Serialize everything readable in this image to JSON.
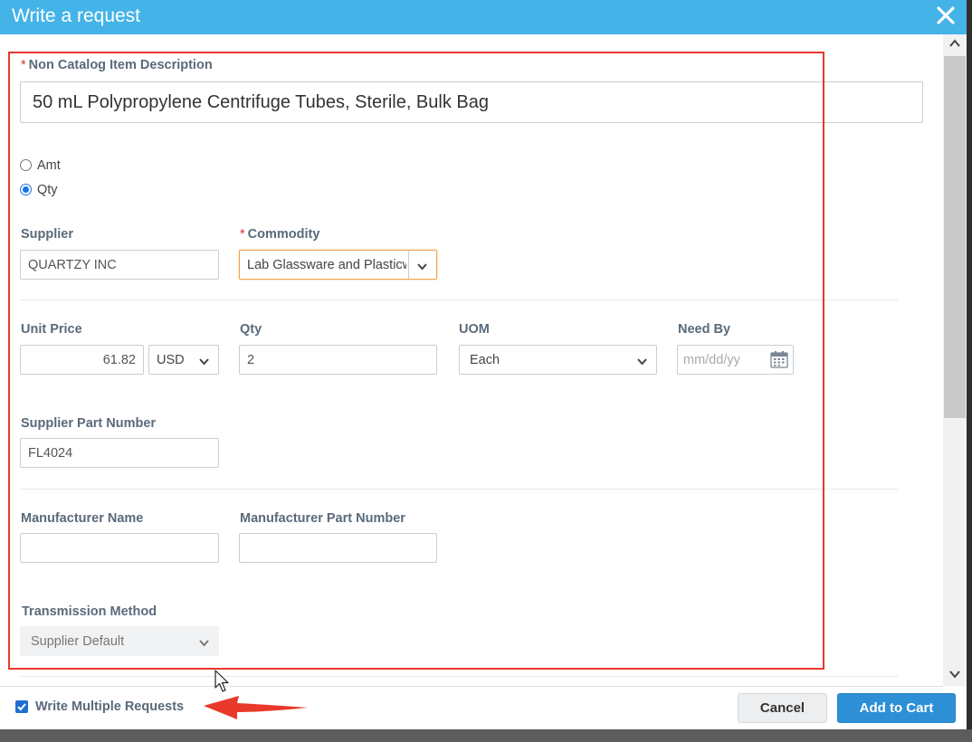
{
  "dialog": {
    "title": "Write a request",
    "colors": {
      "header": "#44b3e8",
      "accent": "#2d8fd5",
      "required": "#d9342b",
      "highlight": "#e8392b"
    }
  },
  "form": {
    "description": {
      "label": "Non Catalog Item Description",
      "value": "50 mL Polypropylene Centrifuge Tubes, Sterile, Bulk Bag"
    },
    "price_type": {
      "options": [
        "Amt",
        "Qty"
      ],
      "selected": "Qty"
    },
    "supplier": {
      "label": "Supplier",
      "value": "QUARTZY INC"
    },
    "commodity": {
      "label": "Commodity",
      "value": "Lab Glassware and Plasticw"
    },
    "unit_price": {
      "label": "Unit Price",
      "value": "61.82",
      "currency": "USD"
    },
    "qty": {
      "label": "Qty",
      "value": "2"
    },
    "uom": {
      "label": "UOM",
      "value": "Each"
    },
    "need_by": {
      "label": "Need By",
      "placeholder": "mm/dd/yy"
    },
    "supplier_part_number": {
      "label": "Supplier Part Number",
      "value": "FL4024"
    },
    "manufacturer_name": {
      "label": "Manufacturer Name",
      "value": ""
    },
    "manufacturer_part_number": {
      "label": "Manufacturer Part Number",
      "value": ""
    },
    "transmission_method": {
      "label": "Transmission Method",
      "value": "Supplier Default"
    }
  },
  "footer": {
    "write_multiple": {
      "label": "Write Multiple Requests",
      "checked": true
    },
    "cancel_label": "Cancel",
    "add_to_cart_label": "Add to Cart"
  },
  "icons": [
    "close-icon",
    "chevron-down-icon",
    "calendar-icon",
    "scroll-up-icon",
    "scroll-down-icon",
    "checkmark-icon",
    "red-arrow-annotation",
    "mouse-cursor-icon"
  ]
}
